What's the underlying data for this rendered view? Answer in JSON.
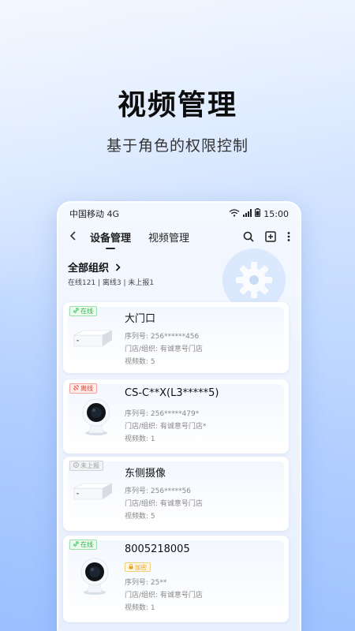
{
  "poster": {
    "title": "视频管理",
    "subtitle": "基于角色的权限控制"
  },
  "status_bar": {
    "carrier": "中国移动 4G",
    "time": "15:00"
  },
  "nav": {
    "back_icon": "chevron-left-icon",
    "tabs": [
      {
        "label": "设备管理",
        "active": true
      },
      {
        "label": "视频管理",
        "active": false
      }
    ],
    "icons": [
      "search-icon",
      "add-icon",
      "more-vertical-icon"
    ]
  },
  "org": {
    "title": "全部组织",
    "stats": "在线121 | 离线3 | 未上报1"
  },
  "devices": [
    {
      "status": "在线",
      "status_type": "online",
      "name": "大门口",
      "serial": "序列号: 256******456",
      "store": "门店/组织: 有诚意号门店",
      "video_count": "视频数: 5",
      "device_type": "nvr"
    },
    {
      "status": "离线",
      "status_type": "offline",
      "name": "CS-C**X(L3*****5)",
      "serial": "序列号: 256*****479*",
      "store": "门店/组织: 有诚意号门店*",
      "video_count": "视频数: 1",
      "device_type": "camera"
    },
    {
      "status": "未上报",
      "status_type": "unreported",
      "name": "东侧摄像",
      "serial": "序列号: 256*****56",
      "store": "门店/组织: 有诚意号门店",
      "video_count": "视频数: 5",
      "device_type": "nvr"
    },
    {
      "status": "在线",
      "status_type": "online",
      "name": "8005218005",
      "encrypt": "加密",
      "serial": "序列号: 25**",
      "store": "门店/组织: 有诚意号门店",
      "video_count": "视频数: 1",
      "device_type": "camera"
    }
  ],
  "colors": {
    "online": "#2fb34a",
    "offline": "#e4473b",
    "unreported": "#9aa0a8",
    "encrypt": "#e8a21c"
  }
}
